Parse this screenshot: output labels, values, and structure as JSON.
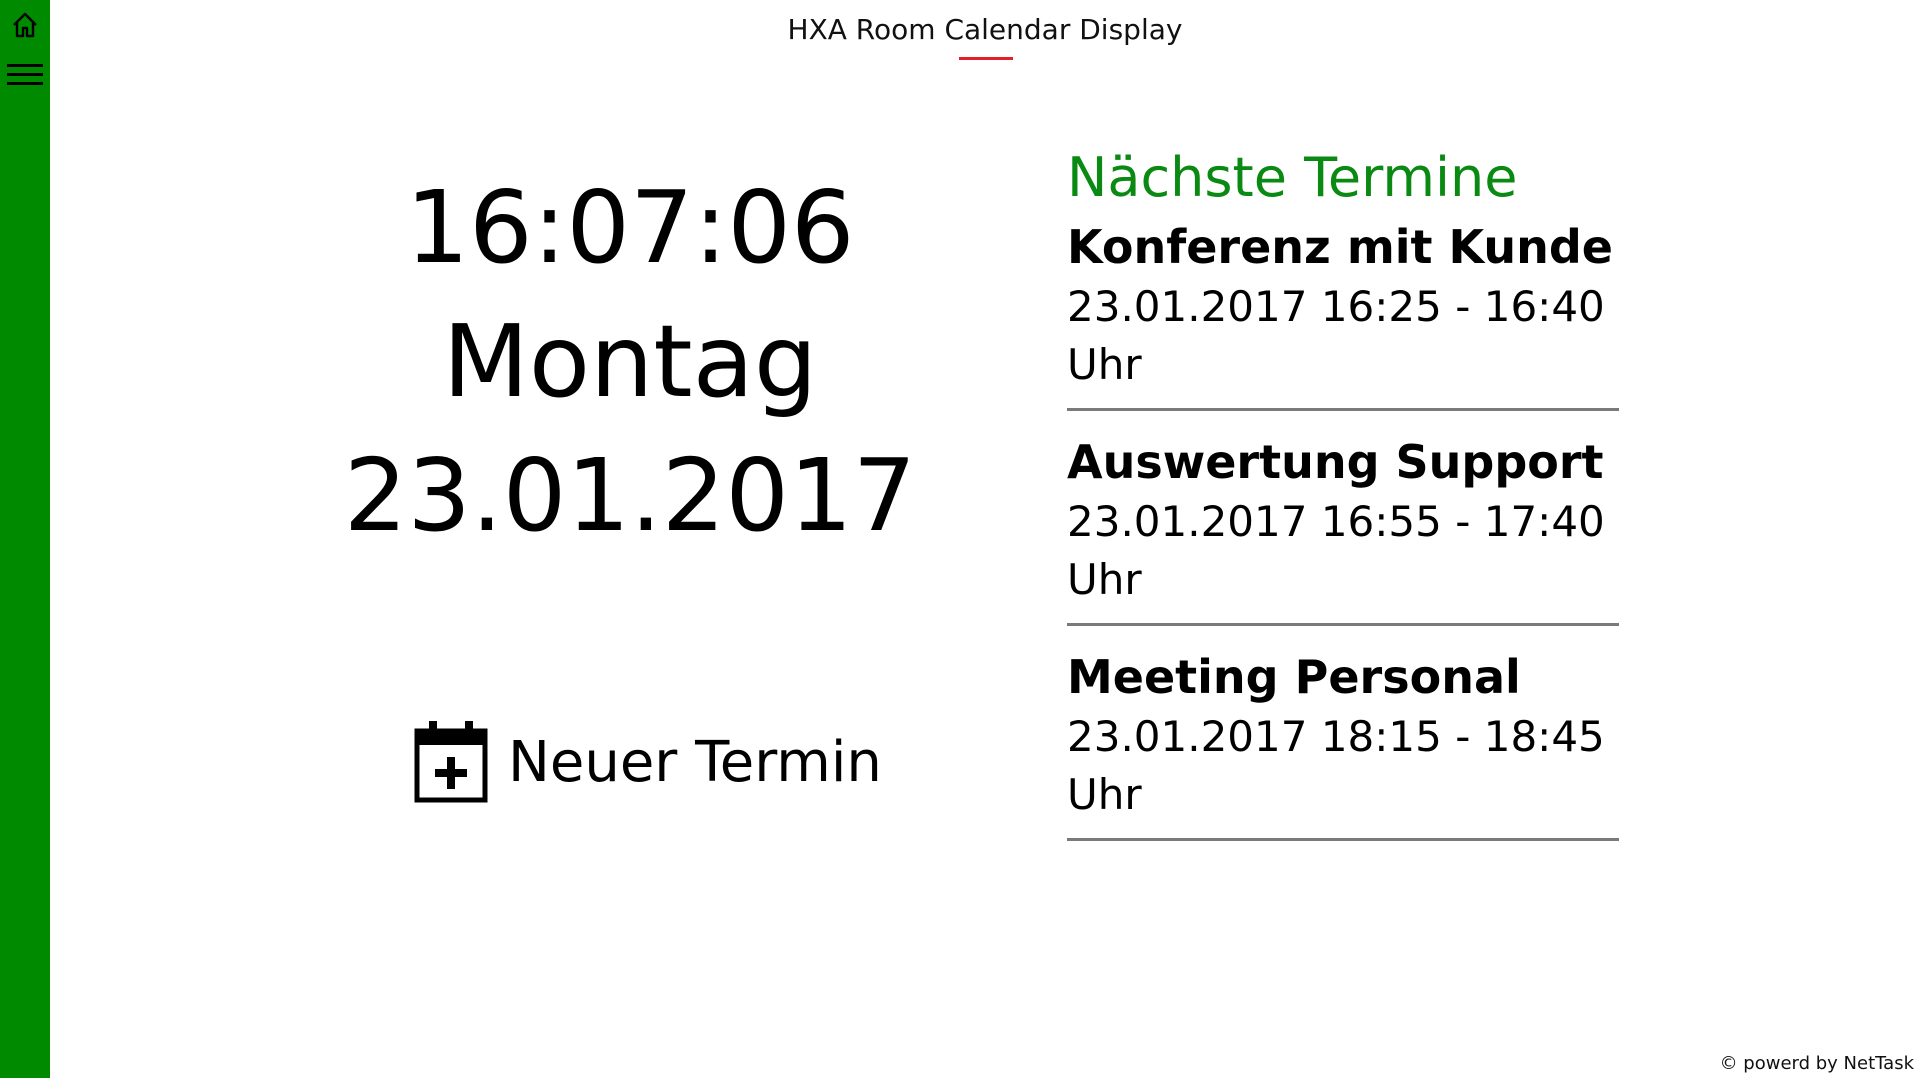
{
  "app": {
    "title": "HXA Room Calendar Display",
    "accent_color": "#008a00",
    "title_underline_color": "#e0202a"
  },
  "sidebar": {
    "home_icon": "home-icon",
    "menu_icon": "hamburger-menu-icon"
  },
  "clock": {
    "time": "16:07:06",
    "weekday": "Montag",
    "date": "23.01.2017"
  },
  "new_appointment": {
    "icon": "calendar-add-icon",
    "label": "Neuer Termin"
  },
  "agenda": {
    "heading": "Nächste Termine",
    "heading_color": "#0a8a12",
    "events": [
      {
        "title": "Konferenz mit Kunde",
        "time": "23.01.2017 16:25 - 16:40 Uhr"
      },
      {
        "title": "Auswertung Support",
        "time": "23.01.2017 16:55 - 17:40 Uhr"
      },
      {
        "title": "Meeting Personal",
        "time": "23.01.2017 18:15 - 18:45 Uhr"
      }
    ]
  },
  "footer": {
    "text": "© powerd by NetTask"
  }
}
